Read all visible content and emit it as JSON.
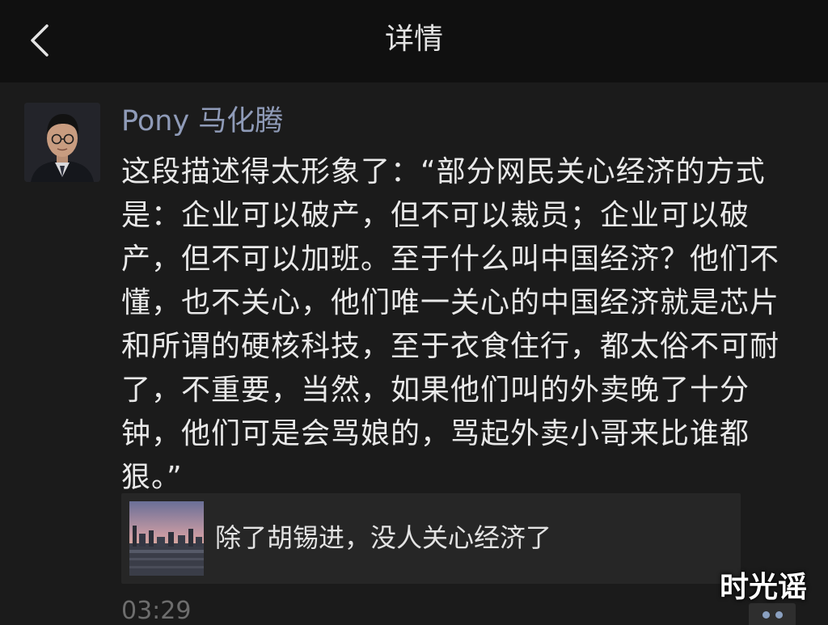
{
  "header": {
    "title": "详情",
    "back_icon": "chevron-left-icon"
  },
  "post": {
    "author": "Pony 马化腾",
    "content": "这段描述得太形象了：“部分网民关心经济的方式是：企业可以破产，但不可以裁员；企业可以破产，但不可以加班。至于什么叫中国经济？他们不懂，也不关心，他们唯一关心的中国经济就是芯片和所谓的硬核科技，至于衣食住行，都太俗不可耐了，不重要，当然，如果他们叫的外卖晚了十分钟，他们可是会骂娘的，骂起外卖小哥来比谁都狠。”",
    "link_card": {
      "title": "除了胡锡进，没人关心经济了",
      "thumbnail_icon": "city-skyline-thumbnail"
    },
    "time": "03:29",
    "more_icon": "more-dots-icon"
  },
  "watermark": "时光谣",
  "colors": {
    "background": "#1b1b1b",
    "header_bg": "#101010",
    "author": "#8f9bb8",
    "text": "#e9e9e9",
    "card_bg": "#262626",
    "time": "#6d6d6d"
  }
}
